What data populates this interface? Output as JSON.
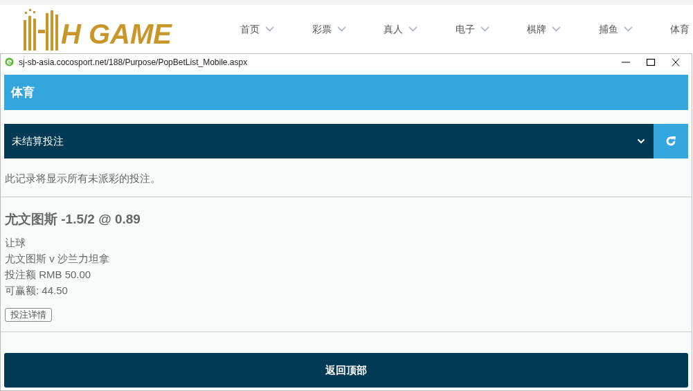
{
  "site": {
    "logo_text": "H GAME",
    "nav": [
      {
        "label": "首页",
        "has_menu": true
      },
      {
        "label": "彩票",
        "has_menu": true
      },
      {
        "label": "真人",
        "has_menu": true
      },
      {
        "label": "电子",
        "has_menu": true
      },
      {
        "label": "棋牌",
        "has_menu": true
      },
      {
        "label": "捕鱼",
        "has_menu": true
      },
      {
        "label": "体育",
        "has_menu": false
      }
    ]
  },
  "popup": {
    "url": "sj-sb-asia.cocosport.net/188/Purpose/PopBetList_Mobile.aspx",
    "header": "体育",
    "filter": {
      "value": "未结算投注"
    },
    "info": "此记录将显示所有未派彩的投注。",
    "bets": [
      {
        "title": "尤文图斯 -1.5/2 @ 0.89",
        "lines": [
          "让球",
          "尤文图斯 v 沙兰力坦拿",
          "投注额 RMB 50.00",
          "可赢额: 44.50"
        ],
        "details_button": "投注详情"
      }
    ],
    "back_to_top": "返回顶部"
  }
}
